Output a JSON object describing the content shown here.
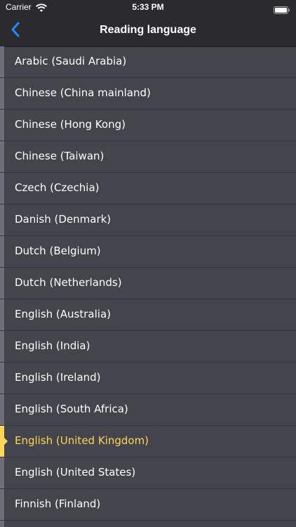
{
  "status_bar": {
    "carrier": "Carrier",
    "time": "5:33 PM",
    "wifi_icon": "wifi-icon",
    "battery_icon": "battery-icon"
  },
  "nav": {
    "back_icon": "chevron-left-icon",
    "title": "Reading language"
  },
  "colors": {
    "background": "#44444d",
    "bar": "#2b2b2f",
    "accent": "#ffd45a",
    "back_blue": "#1a8cff"
  },
  "languages": [
    {
      "label": "Arabic (Saudi Arabia)",
      "selected": false
    },
    {
      "label": "Chinese (China mainland)",
      "selected": false
    },
    {
      "label": "Chinese (Hong Kong)",
      "selected": false
    },
    {
      "label": "Chinese (Taiwan)",
      "selected": false
    },
    {
      "label": "Czech (Czechia)",
      "selected": false
    },
    {
      "label": "Danish (Denmark)",
      "selected": false
    },
    {
      "label": "Dutch (Belgium)",
      "selected": false
    },
    {
      "label": "Dutch (Netherlands)",
      "selected": false
    },
    {
      "label": "English (Australia)",
      "selected": false
    },
    {
      "label": "English (India)",
      "selected": false
    },
    {
      "label": "English (Ireland)",
      "selected": false
    },
    {
      "label": "English (South Africa)",
      "selected": false
    },
    {
      "label": "English (United Kingdom)",
      "selected": true
    },
    {
      "label": "English (United States)",
      "selected": false
    },
    {
      "label": "Finnish (Finland)",
      "selected": false
    },
    {
      "label": "",
      "selected": false
    }
  ]
}
